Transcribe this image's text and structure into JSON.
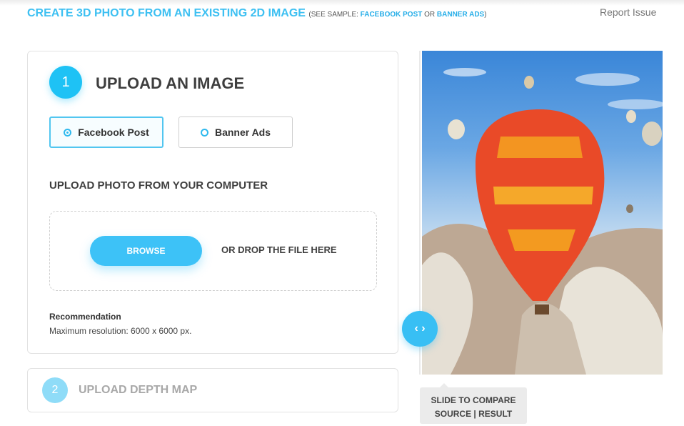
{
  "header": {
    "title": "CREATE 3D PHOTO FROM AN EXISTING 2D IMAGE",
    "sample_prefix": "(SEE SAMPLE:",
    "sample_link_1": "FACEBOOK POST",
    "sample_or": "OR",
    "sample_link_2": "BANNER ADS",
    "sample_suffix": ")",
    "report_issue": "Report Issue"
  },
  "step1": {
    "number": "1",
    "title": "UPLOAD AN IMAGE",
    "options": [
      {
        "label": "Facebook Post",
        "selected": true
      },
      {
        "label": "Banner Ads",
        "selected": false
      }
    ],
    "upload_label": "UPLOAD PHOTO FROM YOUR COMPUTER",
    "browse_label": "BROWSE",
    "drop_text": "OR DROP THE FILE HERE",
    "recommendation_title": "Recommendation",
    "recommendation_text": "Maximum resolution: 6000 x 6000 px."
  },
  "step2": {
    "number": "2",
    "title": "UPLOAD DEPTH MAP"
  },
  "preview": {
    "image": "hot-air-balloon-photo",
    "compare_icon": "chevron-left-right-icon",
    "compare_glyph": "‹ ›",
    "tooltip_line1": "SLIDE TO COMPARE",
    "tooltip_line2": "SOURCE | RESULT"
  },
  "colors": {
    "accent": "#3dc0f2",
    "step_circle": "#1ec2f5",
    "step2_circle": "#8fdcf8"
  }
}
